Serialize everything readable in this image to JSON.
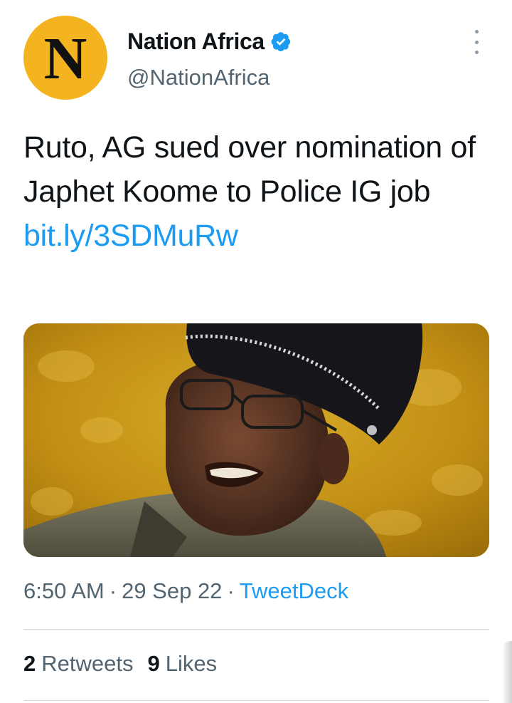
{
  "account": {
    "avatar_letter": "N",
    "display_name": "Nation Africa",
    "handle": "@NationAfrica",
    "verified": true
  },
  "tweet": {
    "text": "Ruto, AG sued over nomination of Japhet Koome to Police IG job",
    "link": "bit.ly/3SDMuRw",
    "image_alt": "Portrait of a police officer in uniform cap and glasses against a gold background"
  },
  "meta": {
    "time": "6:50 AM",
    "separator": "·",
    "date": "29 Sep 22",
    "source": "TweetDeck"
  },
  "stats": {
    "retweets_count": "2",
    "retweets_label": "Retweets",
    "likes_count": "9",
    "likes_label": "Likes"
  },
  "colors": {
    "accent": "#1d9bf0",
    "avatar_bg": "#f3b41f",
    "muted": "#536471"
  },
  "icons": {
    "verified": "verified-badge-icon",
    "more": "more-vertical-icon"
  }
}
